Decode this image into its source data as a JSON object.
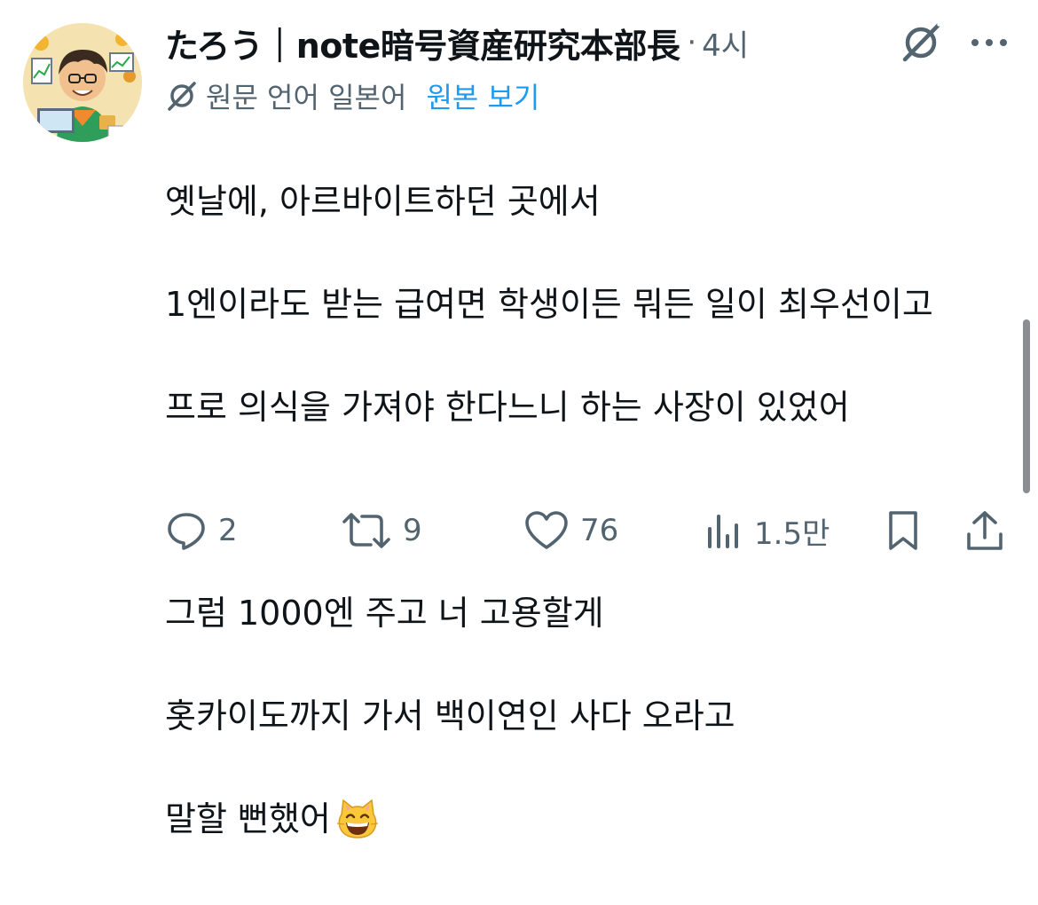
{
  "author": {
    "display_name": "たろう｜note暗号資産研究本部長",
    "avatar_alt": "avatar"
  },
  "tweet": {
    "separator": "·",
    "timestamp": "4시",
    "translation_label": "원문 언어 일본어",
    "view_original_label": "원본 보기",
    "lines": [
      "옛날에, 아르바이트하던 곳에서",
      "1엔이라도 받는 급여면 학생이든 뭐든 일이 최우선이고",
      "프로 의식을 가져야 한다느니 하는 사장이 있었어",
      "",
      "그럼 1000엔 주고 너 고용할게",
      "홋카이도까지 가서 백이연인 사다 오라고",
      "말할 뻔했어"
    ]
  },
  "actions": {
    "replies": "2",
    "retweets": "9",
    "likes": "76",
    "views": "1.5만"
  },
  "icons": {
    "grok": "grok-icon",
    "more": "more-icon",
    "reply": "reply-icon",
    "retweet": "retweet-icon",
    "like": "heart-icon",
    "views": "views-icon",
    "bookmark": "bookmark-icon",
    "share": "share-icon",
    "translate": "grok-icon",
    "emoji": "grinning-cat-emoji"
  },
  "colors": {
    "text": "#0f1419",
    "secondary": "#536471",
    "link": "#1d9bf0"
  }
}
